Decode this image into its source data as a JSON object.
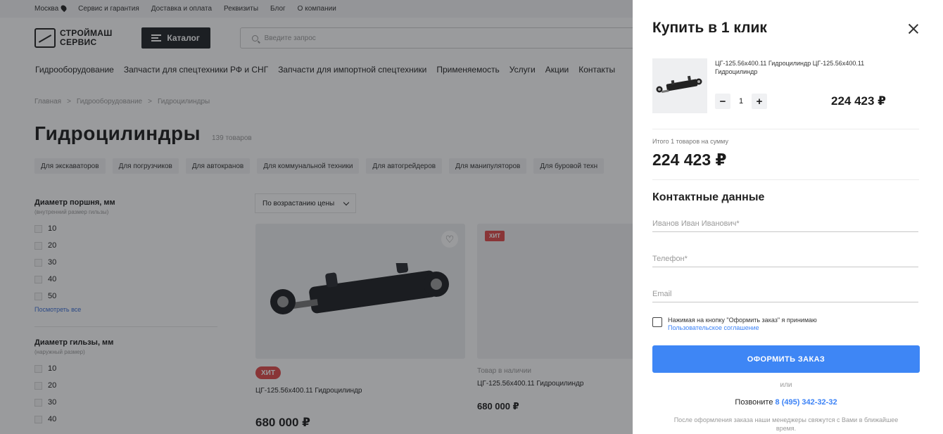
{
  "topbar": {
    "city": "Москва",
    "links": [
      "Сервис и гарантия",
      "Доставка и оплата",
      "Реквизиты",
      "Блог",
      "О компании"
    ]
  },
  "header": {
    "logo_line1": "СТРОЙМАШ",
    "logo_line2": "СЕРВИС",
    "catalog_label": "Каталог",
    "search_placeholder": "Введите запрос"
  },
  "nav": [
    "Гидрооборудование",
    "Запчасти для спецтехники РФ и СНГ",
    "Запчасти для импортной спецтехники",
    "Применяемость",
    "Услуги",
    "Акции",
    "Контакты"
  ],
  "breadcrumb": [
    "Главная",
    ">",
    "Гидрооборудование",
    ">",
    "Гидроцилиндры"
  ],
  "page": {
    "title": "Гидроцилиндры",
    "count": "139 товаров",
    "sort_label": "По возрастанию цены"
  },
  "chips": [
    "Для экскаваторов",
    "Для погрузчиков",
    "Для автокранов",
    "Для коммунальной техники",
    "Для автогрейдеров",
    "Для манипуляторов",
    "Для буровой техн"
  ],
  "filters": [
    {
      "title": "Диаметр поршня, мм",
      "subtitle": "(внутренний размер гильзы)",
      "options": [
        "10",
        "20",
        "30",
        "40",
        "50"
      ],
      "link": "Посмотреть все"
    },
    {
      "title": "Диаметр гильзы, мм",
      "subtitle": "(наружный размер)",
      "options": [
        "10",
        "20",
        "30",
        "40"
      ]
    }
  ],
  "products": [
    {
      "badge": "ХИТ",
      "name": "ЦГ-125.56х400.11 Гидроцилиндр",
      "price": "680 000 ₽"
    },
    {
      "badge": "ХИТ",
      "stock": "Товар в наличии",
      "name": "ЦГ-125.56х400.11 Гидроцилиндр",
      "price": "680 000 ₽"
    }
  ],
  "drawer": {
    "title": "Купить в 1 клик",
    "item": {
      "name": "ЦГ-125.56х400.11 Гидроцилиндр ЦГ-125.56х400.11 Гидроцилиндр",
      "qty": "1",
      "minus": "−",
      "plus": "+",
      "price": "224 423 ₽"
    },
    "total_label": "Итого 1 товаров на сумму",
    "total_value": "224 423 ₽",
    "contact_title": "Контактные данные",
    "name_placeholder": "Иванов Иван Иванович*",
    "phone_placeholder": "Телефон*",
    "email_placeholder": "Email",
    "agree_text": "Нажимая на кнопку \"Оформить заказ\" я принимаю",
    "agree_link": "Пользовательское соглашение",
    "submit_label": "ОФОРМИТЬ ЗАКАЗ",
    "or_label": "или",
    "call_label": "Позвоните",
    "call_phone": "8 (495) 342-32-32",
    "note": "После оформления заказа наши менеджеры свяжутся с Вами в ближайшее время."
  },
  "colors": {
    "accent": "#3e86f5",
    "badge": "#e04a4a",
    "overlay": "rgba(25,28,32,0.44)"
  }
}
